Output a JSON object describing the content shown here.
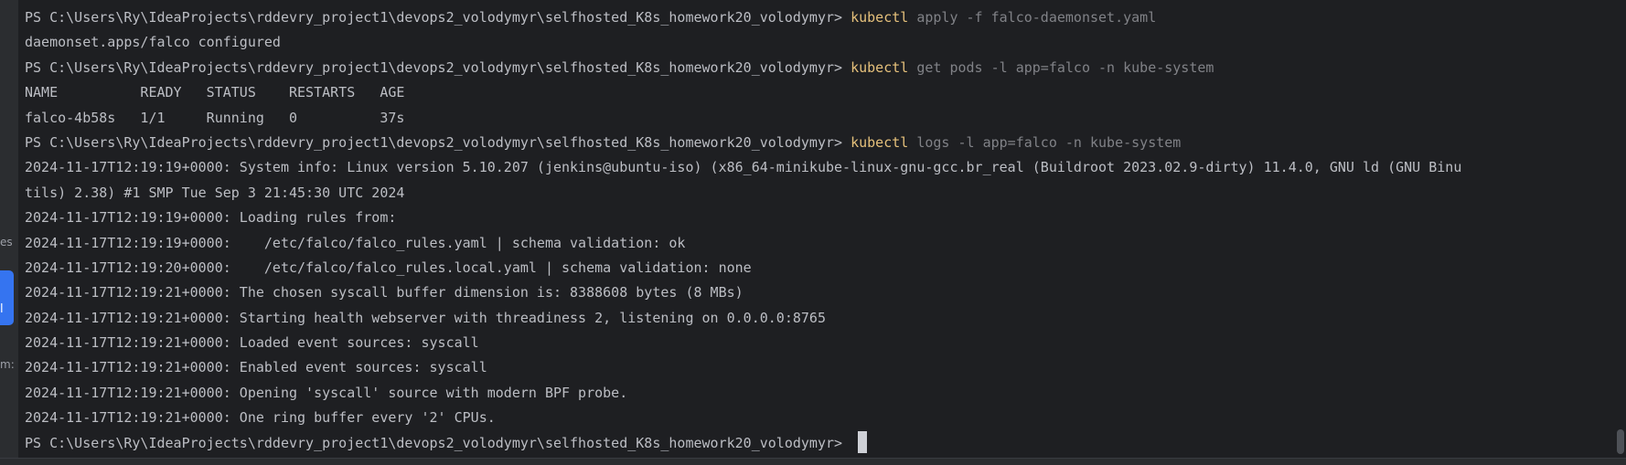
{
  "sidebar": {
    "fragments": [
      "es",
      "al",
      "m:"
    ]
  },
  "terminal": {
    "top_partial": "  ",
    "lines": [
      {
        "type": "cmd",
        "prompt": "PS C:\\Users\\Ry\\IdeaProjects\\rddevry_project1\\devops2_volodymyr\\selfhosted_K8s_homework20_volodymyr> ",
        "command": "kubectl",
        "args": " apply -f falco-daemonset.yaml"
      },
      {
        "type": "out",
        "text": "daemonset.apps/falco configured"
      },
      {
        "type": "cmd",
        "prompt": "PS C:\\Users\\Ry\\IdeaProjects\\rddevry_project1\\devops2_volodymyr\\selfhosted_K8s_homework20_volodymyr> ",
        "command": "kubectl",
        "args": " get pods -l app=falco -n kube-system"
      },
      {
        "type": "out",
        "text": "NAME          READY   STATUS    RESTARTS   AGE"
      },
      {
        "type": "out",
        "text": "falco-4b58s   1/1     Running   0          37s"
      },
      {
        "type": "cmd",
        "prompt": "PS C:\\Users\\Ry\\IdeaProjects\\rddevry_project1\\devops2_volodymyr\\selfhosted_K8s_homework20_volodymyr> ",
        "command": "kubectl",
        "args": " logs -l app=falco -n kube-system"
      },
      {
        "type": "out",
        "text": "2024-11-17T12:19:19+0000: System info: Linux version 5.10.207 (jenkins@ubuntu-iso) (x86_64-minikube-linux-gnu-gcc.br_real (Buildroot 2023.02.9-dirty) 11.4.0, GNU ld (GNU Binu"
      },
      {
        "type": "out",
        "text": "tils) 2.38) #1 SMP Tue Sep 3 21:45:30 UTC 2024"
      },
      {
        "type": "out",
        "text": "2024-11-17T12:19:19+0000: Loading rules from:"
      },
      {
        "type": "out",
        "text": "2024-11-17T12:19:19+0000:    /etc/falco/falco_rules.yaml | schema validation: ok"
      },
      {
        "type": "out",
        "text": "2024-11-17T12:19:20+0000:    /etc/falco/falco_rules.local.yaml | schema validation: none"
      },
      {
        "type": "out",
        "text": "2024-11-17T12:19:21+0000: The chosen syscall buffer dimension is: 8388608 bytes (8 MBs)"
      },
      {
        "type": "out",
        "text": "2024-11-17T12:19:21+0000: Starting health webserver with threadiness 2, listening on 0.0.0.0:8765"
      },
      {
        "type": "out",
        "text": "2024-11-17T12:19:21+0000: Loaded event sources: syscall"
      },
      {
        "type": "out",
        "text": "2024-11-17T12:19:21+0000: Enabled event sources: syscall"
      },
      {
        "type": "out",
        "text": "2024-11-17T12:19:21+0000: Opening 'syscall' source with modern BPF probe."
      },
      {
        "type": "out",
        "text": "2024-11-17T12:19:21+0000: One ring buffer every '2' CPUs."
      },
      {
        "type": "prompt",
        "prompt": "PS C:\\Users\\Ry\\IdeaProjects\\rddevry_project1\\devops2_volodymyr\\selfhosted_K8s_homework20_volodymyr> "
      }
    ]
  },
  "colors": {
    "background": "#1e1f22",
    "command": "#e5c07b",
    "text": "#bcbec4",
    "accent": "#3574f0"
  }
}
